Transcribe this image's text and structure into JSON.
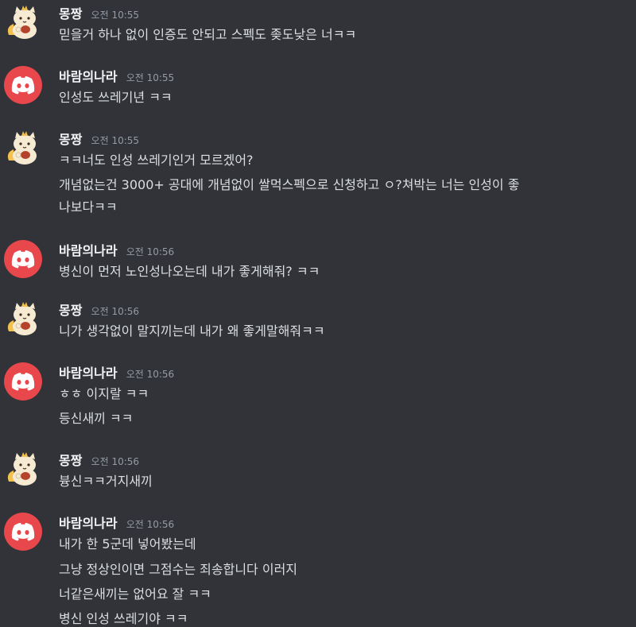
{
  "messages": [
    {
      "user": "몽짱",
      "avatar": "cat-avatar",
      "time": "오전 10:55",
      "lines": [
        "믿을거 하나 없이 인증도 안되고 스펙도 좆도낮은 너ㅋㅋ"
      ]
    },
    {
      "user": "바람의나라",
      "avatar": "discord-avatar",
      "time": "오전 10:55",
      "lines": [
        "인성도 쓰레기년 ㅋㅋ"
      ]
    },
    {
      "user": "몽짱",
      "avatar": "cat-avatar",
      "time": "오전 10:55",
      "lines": [
        "ㅋㅋ너도 인성 쓰레기인거 모르겠어?",
        "개념없는건 3000+ 공대에 개념없이 쌀먹스펙으로 신청하고 ㅇ?쳐박는 너는 인성이 좋",
        "나보다ㅋㅋ"
      ]
    },
    {
      "user": "바람의나라",
      "avatar": "discord-avatar",
      "time": "오전 10:56",
      "lines": [
        "병신이 먼저 노인성나오는데 내가 좋게해줘? ㅋㅋ"
      ]
    },
    {
      "user": "몽짱",
      "avatar": "cat-avatar",
      "time": "오전 10:56",
      "lines": [
        "니가 생각없이 말지끼는데 내가 왜 좋게말해줘ㅋㅋ"
      ]
    },
    {
      "user": "바람의나라",
      "avatar": "discord-avatar",
      "time": "오전 10:56",
      "lines": [
        "ㅎㅎ 이지랄 ㅋㅋ",
        "등신새끼 ㅋㅋ"
      ]
    },
    {
      "user": "몽짱",
      "avatar": "cat-avatar",
      "time": "오전 10:56",
      "lines": [
        "븅신ㅋㅋ거지새끼"
      ]
    },
    {
      "user": "바람의나라",
      "avatar": "discord-avatar",
      "time": "오전 10:56",
      "lines": [
        "내가 한 5군데 넣어봤는데",
        "그냥 정상인이면 그점수는 죄송합니다 이러지",
        "너같은새끼는 없어요 잘 ㅋㅋ",
        "병신 인성 쓰레기야 ㅋㅋ"
      ]
    }
  ]
}
